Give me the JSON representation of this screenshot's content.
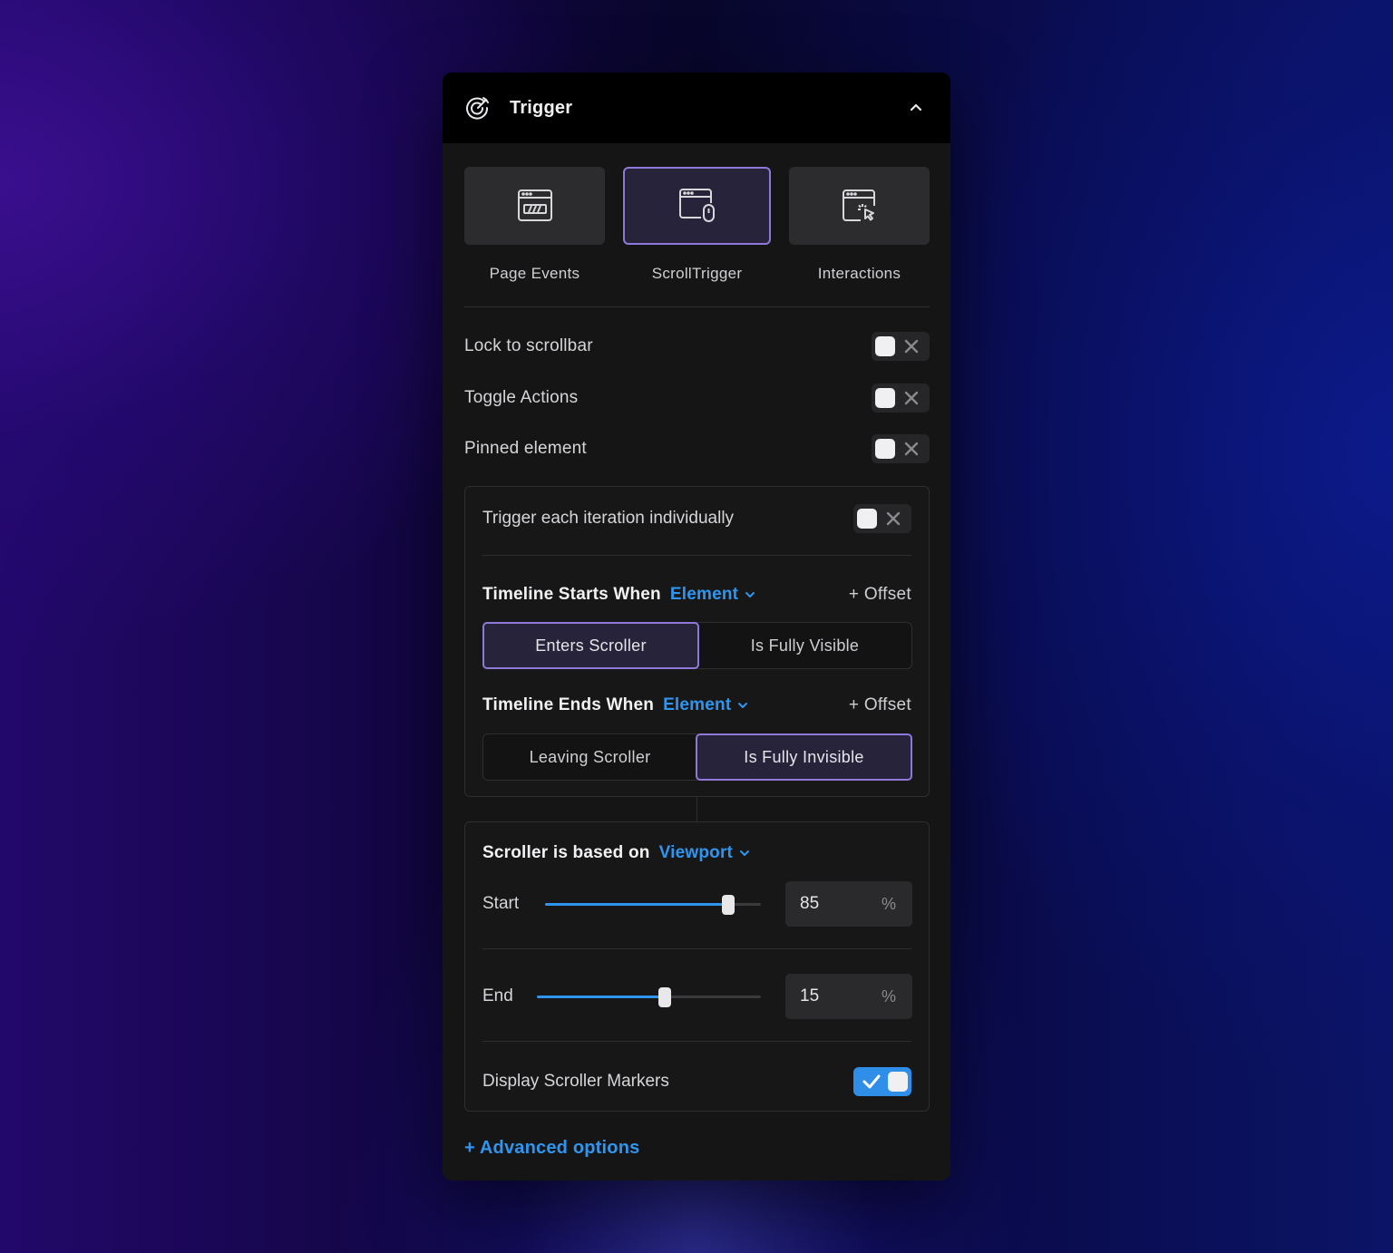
{
  "header": {
    "title": "Trigger"
  },
  "tiles": [
    {
      "label": "Page Events",
      "icon": "page-events-icon",
      "active": false
    },
    {
      "label": "ScrollTrigger",
      "icon": "scroll-trigger-icon",
      "active": true
    },
    {
      "label": "Interactions",
      "icon": "interactions-icon",
      "active": false
    }
  ],
  "toggles": {
    "lock_to_scrollbar": {
      "label": "Lock to scrollbar",
      "on": false
    },
    "toggle_actions": {
      "label": "Toggle Actions",
      "on": false
    },
    "pinned_element": {
      "label": "Pinned element",
      "on": false
    }
  },
  "timeline_card": {
    "iteration": {
      "label": "Trigger each iteration individually",
      "on": false
    },
    "starts": {
      "label": "Timeline Starts When",
      "target": "Element",
      "offset": "+ Offset",
      "options": [
        "Enters Scroller",
        "Is Fully Visible"
      ],
      "selected": "Enters Scroller"
    },
    "ends": {
      "label": "Timeline Ends When",
      "target": "Element",
      "offset": "+ Offset",
      "options": [
        "Leaving Scroller",
        "Is Fully Invisible"
      ],
      "selected": "Is Fully Invisible"
    }
  },
  "scroller_card": {
    "label": "Scroller is based on",
    "target": "Viewport",
    "start": {
      "label": "Start",
      "value": "85",
      "unit": "%",
      "level": 0.85
    },
    "end": {
      "label": "End",
      "value": "15",
      "unit": "%",
      "level": 0.57
    },
    "markers": {
      "label": "Display Scroller Markers",
      "on": true
    }
  },
  "advanced": {
    "label": "+ Advanced options"
  },
  "colors": {
    "accent": "#2f95ef",
    "selected_border": "#8e79d8",
    "panel_bg": "#151515"
  }
}
